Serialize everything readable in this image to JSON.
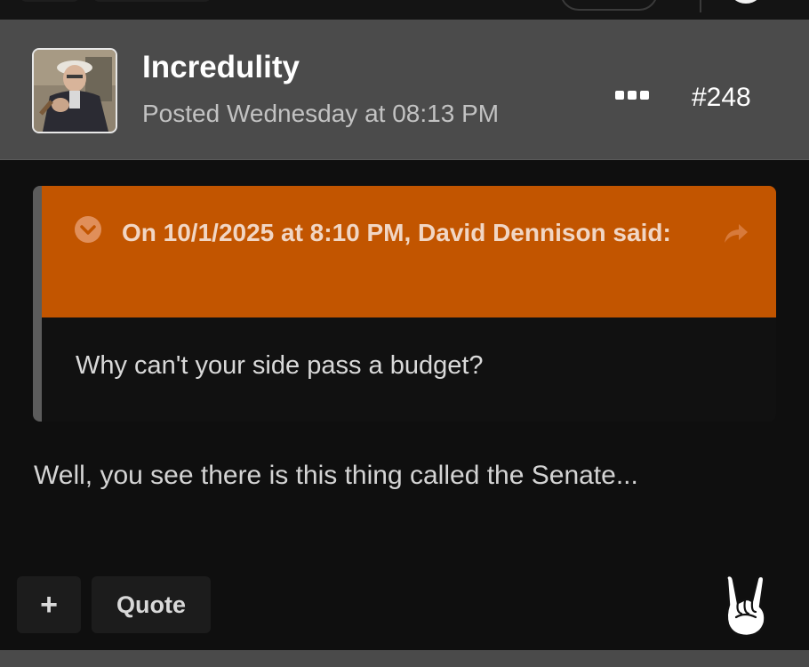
{
  "post": {
    "author": "Incredulity",
    "posted": "Posted Wednesday at 08:13 PM",
    "number": "#248",
    "avatar_icon": "user-photo-avatar",
    "more_icon": "ellipsis-icon"
  },
  "quote": {
    "citation": "On 10/1/2025 at 8:10 PM, David Dennison said:",
    "body": "Why can't your side pass a budget?",
    "toggle_icon": "chevron-down-circle-icon",
    "share_icon": "share-arrow-icon",
    "accent_color": "#c25500"
  },
  "content": {
    "text": "Well, you see there is this thing called the Senate..."
  },
  "actions": {
    "plus_label": "+",
    "quote_label": "Quote",
    "reaction_icon": "rock-on-hand-icon"
  }
}
